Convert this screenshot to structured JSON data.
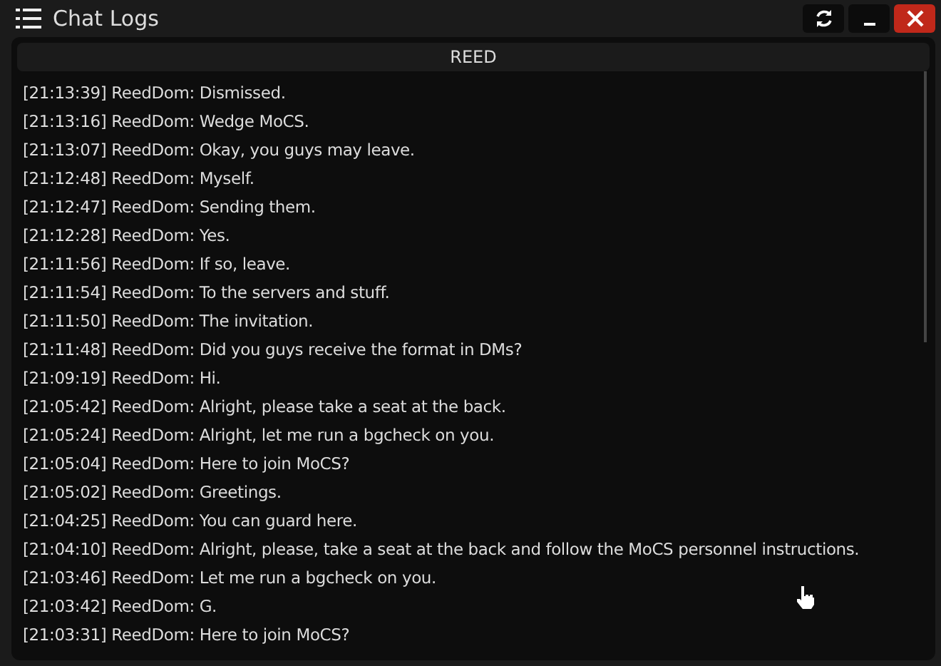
{
  "window": {
    "title": "Chat Logs"
  },
  "channel": {
    "name": "REED"
  },
  "messages": [
    {
      "time": "[21:13:39]",
      "author": "ReedDom:",
      "text": "Dismissed."
    },
    {
      "time": "[21:13:16]",
      "author": "ReedDom:",
      "text": "Wedge MoCS."
    },
    {
      "time": "[21:13:07]",
      "author": "ReedDom:",
      "text": "Okay, you guys may leave."
    },
    {
      "time": "[21:12:48]",
      "author": "ReedDom:",
      "text": "Myself."
    },
    {
      "time": "[21:12:47]",
      "author": "ReedDom:",
      "text": "Sending them."
    },
    {
      "time": "[21:12:28]",
      "author": "ReedDom:",
      "text": "Yes."
    },
    {
      "time": "[21:11:56]",
      "author": "ReedDom:",
      "text": "If so, leave."
    },
    {
      "time": "[21:11:54]",
      "author": "ReedDom:",
      "text": "To the servers and stuff."
    },
    {
      "time": "[21:11:50]",
      "author": "ReedDom:",
      "text": "The invitation."
    },
    {
      "time": "[21:11:48]",
      "author": "ReedDom:",
      "text": "Did you guys receive the format in DMs?"
    },
    {
      "time": "[21:09:19]",
      "author": "ReedDom:",
      "text": "Hi."
    },
    {
      "time": "[21:05:42]",
      "author": "ReedDom:",
      "text": "Alright, please take a seat at the back."
    },
    {
      "time": "[21:05:24]",
      "author": "ReedDom:",
      "text": "Alright, let me run a bgcheck on you."
    },
    {
      "time": "[21:05:04]",
      "author": "ReedDom:",
      "text": "Here to join MoCS?"
    },
    {
      "time": "[21:05:02]",
      "author": "ReedDom:",
      "text": "Greetings."
    },
    {
      "time": "[21:04:25]",
      "author": "ReedDom:",
      "text": "You can guard here."
    },
    {
      "time": "[21:04:10]",
      "author": "ReedDom:",
      "text": "Alright, please, take a seat at the back and follow the MoCS personnel instructions."
    },
    {
      "time": "[21:03:46]",
      "author": "ReedDom:",
      "text": "Let me run a bgcheck on you."
    },
    {
      "time": "[21:03:42]",
      "author": "ReedDom:",
      "text": "G."
    },
    {
      "time": "[21:03:31]",
      "author": "ReedDom:",
      "text": "Here to join MoCS?"
    }
  ]
}
